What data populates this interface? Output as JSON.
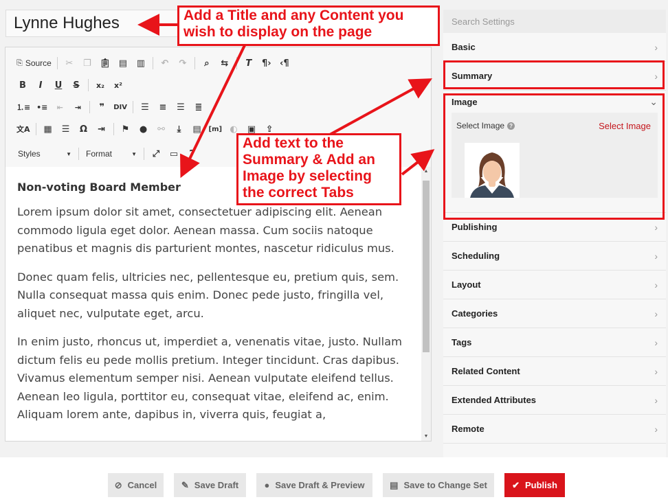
{
  "title_value": "Lynne Hughes",
  "toolbar": {
    "source_label": "Source",
    "styles_label": "Styles",
    "format_label": "Format"
  },
  "content": {
    "heading": "Non-voting Board Member",
    "paragraphs": [
      "Lorem ipsum dolor sit amet, consectetuer adipiscing elit. Aenean commodo ligula eget dolor. Aenean massa. Cum sociis natoque penatibus et magnis dis parturient montes, nascetur ridiculus mus.",
      "Donec quam felis, ultricies nec, pellentesque eu, pretium quis, sem. Nulla consequat massa quis enim. Donec pede justo, fringilla vel, aliquet nec, vulputate eget, arcu.",
      "In enim justo, rhoncus ut, imperdiet a, venenatis vitae, justo. Nullam dictum felis eu pede mollis pretium. Integer tincidunt. Cras dapibus. Vivamus elementum semper nisi. Aenean vulputate eleifend tellus. Aenean leo ligula, porttitor eu, consequat vitae, eleifend ac, enim. Aliquam lorem ante, dapibus in, viverra quis, feugiat a,"
    ]
  },
  "sidebar": {
    "search_placeholder": "Search Settings",
    "basic": "Basic",
    "summary": "Summary",
    "image": "Image",
    "select_image_label": "Select Image",
    "select_image_link": "Select Image",
    "items": [
      "Publishing",
      "Scheduling",
      "Layout",
      "Categories",
      "Tags",
      "Related Content",
      "Extended Attributes",
      "Remote"
    ]
  },
  "buttons": {
    "cancel": "Cancel",
    "save_draft": "Save Draft",
    "save_draft_preview": "Save Draft & Preview",
    "save_change_set": "Save to Change Set",
    "publish": "Publish"
  },
  "annotations": {
    "title_callout": "Add a Title and any Content you wish to display on the page",
    "summary_callout": "Add text to the Summary & Add an Image by selecting the correct Tabs"
  },
  "colors": {
    "accent": "#d9141b",
    "annotation": "#e8141a"
  }
}
